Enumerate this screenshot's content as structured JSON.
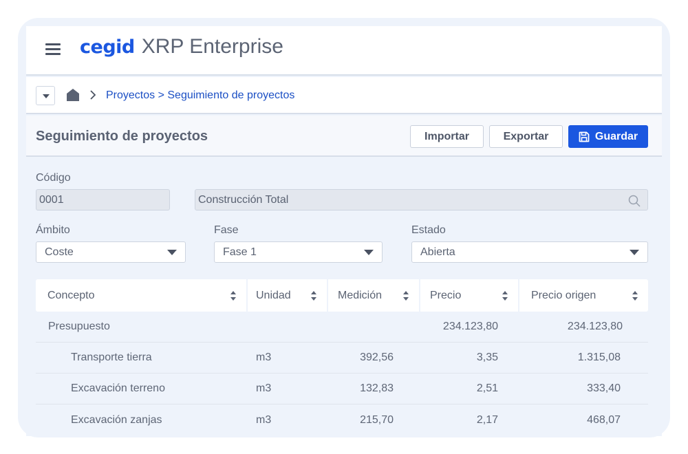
{
  "brand": {
    "logo": "cegid",
    "product": "XRP Enterprise"
  },
  "breadcrumb": {
    "text": "Proyectos > Seguimiento de proyectos"
  },
  "page": {
    "title": "Seguimiento de proyectos"
  },
  "toolbar": {
    "import_label": "Importar",
    "export_label": "Exportar",
    "save_label": "Guardar"
  },
  "form": {
    "code_label": "Código",
    "code_value": "0001",
    "name_value": "Construcción Total",
    "scope_label": "Ámbito",
    "scope_value": "Coste",
    "phase_label": "Fase",
    "phase_value": "Fase 1",
    "status_label": "Estado",
    "status_value": "Abierta"
  },
  "table": {
    "columns": [
      "Concepto",
      "Unidad",
      "Medición",
      "Precio",
      "Precio origen"
    ],
    "rows": [
      {
        "concepto": "Presupuesto",
        "unidad": "",
        "medicion": "",
        "precio": "234.123,80",
        "precio_origen": "234.123,80"
      },
      {
        "concepto": "Transporte tierra",
        "unidad": "m3",
        "medicion": "392,56",
        "precio": "3,35",
        "precio_origen": "1.315,08"
      },
      {
        "concepto": "Excavación terreno",
        "unidad": "m3",
        "medicion": "132,83",
        "precio": "2,51",
        "precio_origen": "333,40"
      },
      {
        "concepto": "Excavación zanjas",
        "unidad": "m3",
        "medicion": "215,70",
        "precio": "2,17",
        "precio_origen": "468,07"
      }
    ]
  },
  "colors": {
    "accent": "#1b57e0",
    "link": "#1b4fc4",
    "background": "#eef3fb"
  },
  "icons": [
    "menu-icon",
    "chevron-down-icon",
    "home-icon",
    "chevron-right-icon",
    "save-icon",
    "search-icon",
    "sort-icon"
  ]
}
